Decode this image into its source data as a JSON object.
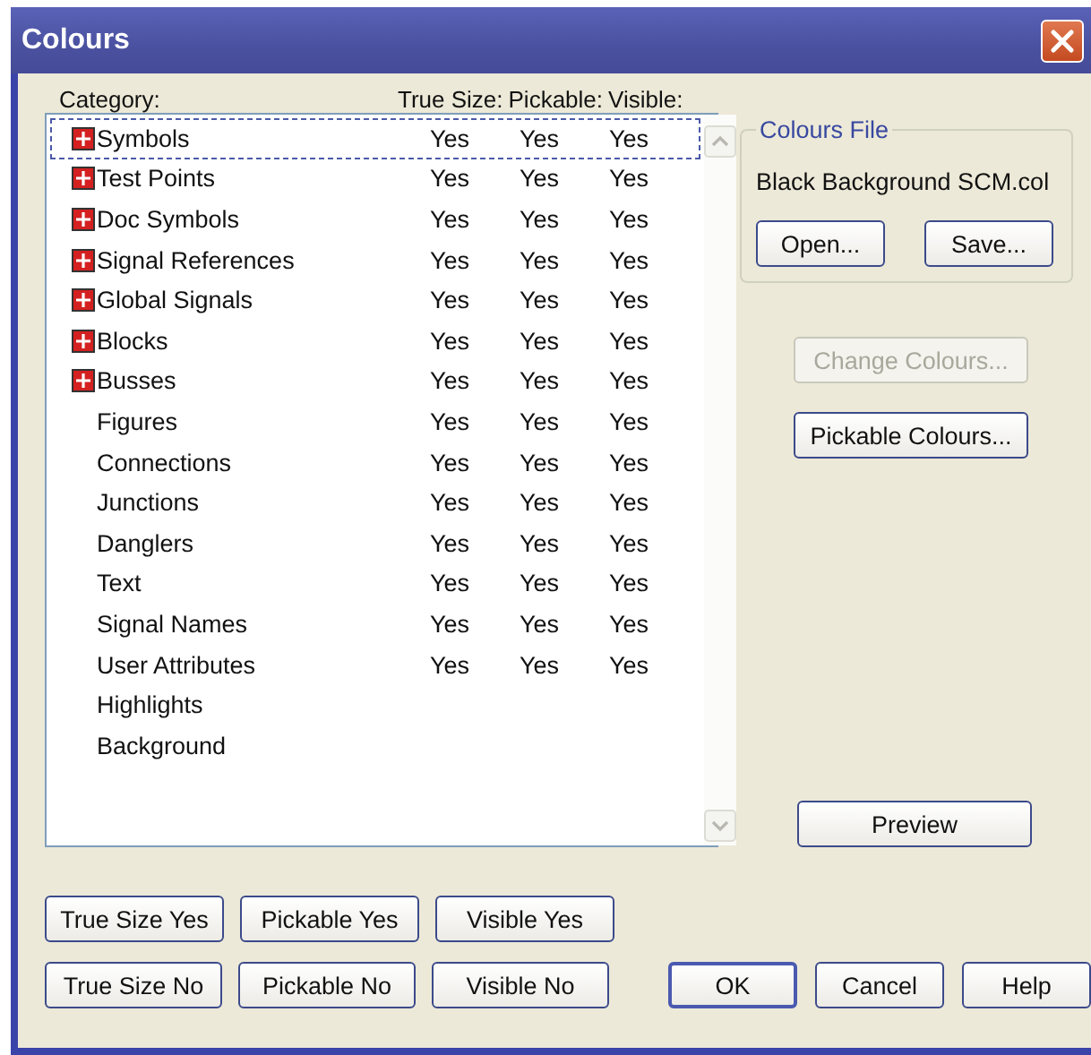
{
  "window": {
    "title": "Colours"
  },
  "list": {
    "headers": [
      "Category:",
      "True Size:",
      "Pickable:",
      "Visible:"
    ],
    "rows": [
      {
        "name": "Symbols",
        "expandable": true,
        "selected": true,
        "true_size": "Yes",
        "pickable": "Yes",
        "visible": "Yes"
      },
      {
        "name": "Test Points",
        "expandable": true,
        "selected": false,
        "true_size": "Yes",
        "pickable": "Yes",
        "visible": "Yes"
      },
      {
        "name": "Doc Symbols",
        "expandable": true,
        "selected": false,
        "true_size": "Yes",
        "pickable": "Yes",
        "visible": "Yes"
      },
      {
        "name": "Signal References",
        "expandable": true,
        "selected": false,
        "true_size": "Yes",
        "pickable": "Yes",
        "visible": "Yes"
      },
      {
        "name": "Global Signals",
        "expandable": true,
        "selected": false,
        "true_size": "Yes",
        "pickable": "Yes",
        "visible": "Yes"
      },
      {
        "name": "Blocks",
        "expandable": true,
        "selected": false,
        "true_size": "Yes",
        "pickable": "Yes",
        "visible": "Yes"
      },
      {
        "name": "Busses",
        "expandable": true,
        "selected": false,
        "true_size": "Yes",
        "pickable": "Yes",
        "visible": "Yes"
      },
      {
        "name": "Figures",
        "expandable": false,
        "selected": false,
        "true_size": "Yes",
        "pickable": "Yes",
        "visible": "Yes"
      },
      {
        "name": "Connections",
        "expandable": false,
        "selected": false,
        "true_size": "Yes",
        "pickable": "Yes",
        "visible": "Yes"
      },
      {
        "name": "Junctions",
        "expandable": false,
        "selected": false,
        "true_size": "Yes",
        "pickable": "Yes",
        "visible": "Yes"
      },
      {
        "name": "Danglers",
        "expandable": false,
        "selected": false,
        "true_size": "Yes",
        "pickable": "Yes",
        "visible": "Yes"
      },
      {
        "name": "Text",
        "expandable": false,
        "selected": false,
        "true_size": "Yes",
        "pickable": "Yes",
        "visible": "Yes"
      },
      {
        "name": "Signal Names",
        "expandable": false,
        "selected": false,
        "true_size": "Yes",
        "pickable": "Yes",
        "visible": "Yes"
      },
      {
        "name": "User Attributes",
        "expandable": false,
        "selected": false,
        "true_size": "Yes",
        "pickable": "Yes",
        "visible": "Yes"
      },
      {
        "name": "Highlights",
        "expandable": false,
        "selected": false
      },
      {
        "name": "Background",
        "expandable": false,
        "selected": false
      }
    ]
  },
  "colours_file": {
    "legend": "Colours File",
    "filename": "Black Background SCM.col",
    "buttons": [
      {
        "label": "Open...",
        "disabled": false
      },
      {
        "label": "Save...",
        "disabled": false
      }
    ]
  },
  "side_buttons": [
    {
      "label": "Change Colours...",
      "disabled": true
    },
    {
      "label": "Pickable Colours...",
      "disabled": false
    }
  ],
  "preview_button": {
    "label": "Preview",
    "disabled": false
  },
  "set_buttons": [
    [
      {
        "label": "True Size Yes"
      },
      {
        "label": "Pickable Yes"
      },
      {
        "label": "Visible Yes"
      }
    ],
    [
      {
        "label": "True Size No"
      },
      {
        "label": "Pickable No"
      },
      {
        "label": "Visible No"
      }
    ]
  ],
  "dialog_buttons": [
    {
      "label": "OK",
      "default": true
    },
    {
      "label": "Cancel",
      "default": false
    },
    {
      "label": "Help",
      "default": false
    }
  ]
}
